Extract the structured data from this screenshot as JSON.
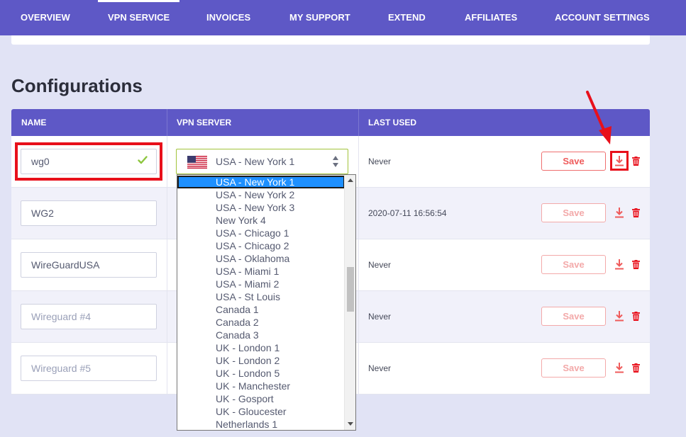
{
  "nav": {
    "items": [
      {
        "label": "OVERVIEW",
        "active": false
      },
      {
        "label": "VPN SERVICE",
        "active": true
      },
      {
        "label": "INVOICES",
        "active": false
      },
      {
        "label": "MY SUPPORT",
        "active": false
      },
      {
        "label": "EXTEND",
        "active": false
      },
      {
        "label": "AFFILIATES",
        "active": false
      },
      {
        "label": "ACCOUNT SETTINGS",
        "active": false
      }
    ]
  },
  "section": {
    "title": "Configurations"
  },
  "table": {
    "headers": {
      "name": "NAME",
      "server": "VPN SERVER",
      "last_used": "LAST USED"
    },
    "rows": [
      {
        "name": "wg0",
        "name_is_placeholder": false,
        "server": "USA - New York 1",
        "last_used": "Never",
        "save_label": "Save",
        "save_enabled": true
      },
      {
        "name": "WG2",
        "name_is_placeholder": false,
        "server": "",
        "last_used": "2020-07-11 16:56:54",
        "save_label": "Save",
        "save_enabled": false
      },
      {
        "name": "WireGuardUSA",
        "name_is_placeholder": false,
        "server": "",
        "last_used": "Never",
        "save_label": "Save",
        "save_enabled": false
      },
      {
        "name": "Wireguard #4",
        "name_is_placeholder": true,
        "server": "",
        "last_used": "Never",
        "save_label": "Save",
        "save_enabled": false
      },
      {
        "name": "Wireguard #5",
        "name_is_placeholder": true,
        "server": "",
        "last_used": "Never",
        "save_label": "Save",
        "save_enabled": false
      }
    ]
  },
  "dropdown": {
    "selected": "USA - New York 1",
    "options": [
      "USA - New York 1",
      "USA - New York 2",
      "USA - New York 3",
      "New York 4",
      "USA - Chicago 1",
      "USA - Chicago 2",
      "USA - Oklahoma",
      "USA - Miami 1",
      "USA - Miami 2",
      "USA - St Louis",
      "Canada 1",
      "Canada 2",
      "Canada 3",
      "UK - London 1",
      "UK - London 2",
      "UK - London 5",
      "UK - Manchester",
      "UK - Gosport",
      "UK - Gloucester",
      "Netherlands 1"
    ]
  },
  "colors": {
    "nav_bg": "#5e58c6",
    "page_bg": "#e1e3f5",
    "accent_red": "#ef5b5b",
    "highlight_red": "#e8101b",
    "check_green": "#8dc63f",
    "select_blue": "#1e90ff"
  },
  "icons": [
    "check-icon",
    "us-flag-icon",
    "select-arrows-icon",
    "download-icon",
    "trash-icon",
    "red-arrow-annotation"
  ]
}
